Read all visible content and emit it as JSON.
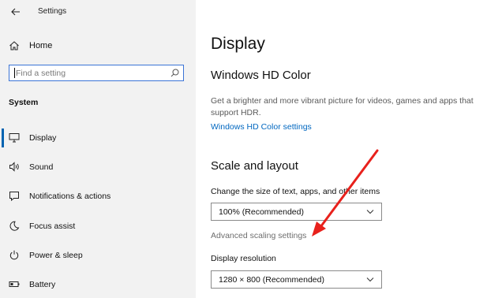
{
  "window": {
    "title": "Settings",
    "back_icon": "arrow-left-icon"
  },
  "sidebar": {
    "home_label": "Home",
    "home_icon": "home-icon",
    "search_placeholder": "Find a setting",
    "search_icon": "search-icon",
    "section_header": "System",
    "items": [
      {
        "label": "Display",
        "icon": "monitor-icon",
        "selected": true
      },
      {
        "label": "Sound",
        "icon": "speaker-icon",
        "selected": false
      },
      {
        "label": "Notifications & actions",
        "icon": "notification-icon",
        "selected": false
      },
      {
        "label": "Focus assist",
        "icon": "moon-icon",
        "selected": false
      },
      {
        "label": "Power & sleep",
        "icon": "power-icon",
        "selected": false
      },
      {
        "label": "Battery",
        "icon": "battery-icon",
        "selected": false
      }
    ]
  },
  "main": {
    "page_title": "Display",
    "hd_color": {
      "heading": "Windows HD Color",
      "description": "Get a brighter and more vibrant picture for videos, games and apps that support HDR.",
      "link": "Windows HD Color settings"
    },
    "scale_layout": {
      "heading": "Scale and layout",
      "scale_label": "Change the size of text, apps, and other items",
      "scale_value": "100% (Recommended)",
      "advanced_link": "Advanced scaling settings",
      "resolution_label": "Display resolution",
      "resolution_value": "1280 × 800 (Recommended)"
    }
  },
  "annotation": {
    "color": "#e8211c"
  },
  "colors": {
    "accent": "#0067c0",
    "sidebar_bg": "#f2f2f2",
    "selection_bar": "#0063b1"
  }
}
